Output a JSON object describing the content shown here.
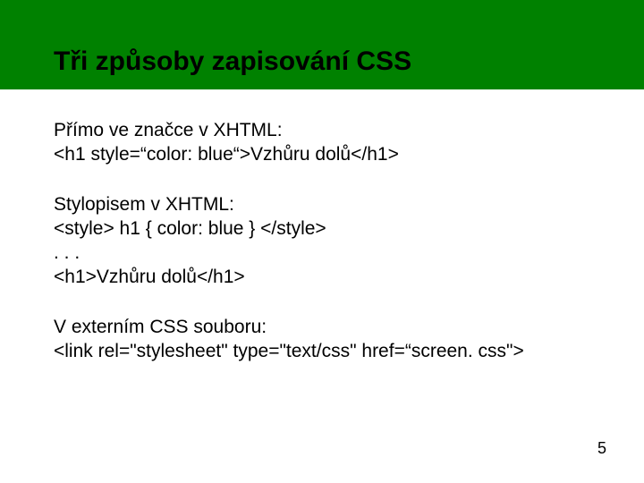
{
  "title": "Tři způsoby zapisování CSS",
  "section1": {
    "line1": "Přímo ve značce v XHTML:",
    "line2": "<h1 style=“color: blue“>Vzhůru dolů</h1>"
  },
  "section2": {
    "line1": "Stylopisem v XHTML:",
    "line2": "<style> h1 { color: blue } </style>",
    "line3": ". . .",
    "line4": "<h1>Vzhůru dolů</h1>"
  },
  "section3": {
    "line1": "V externím CSS souboru:",
    "line2": "<link rel=\"stylesheet\" type=\"text/css\" href=“screen. css\">"
  },
  "pagenum": "5"
}
